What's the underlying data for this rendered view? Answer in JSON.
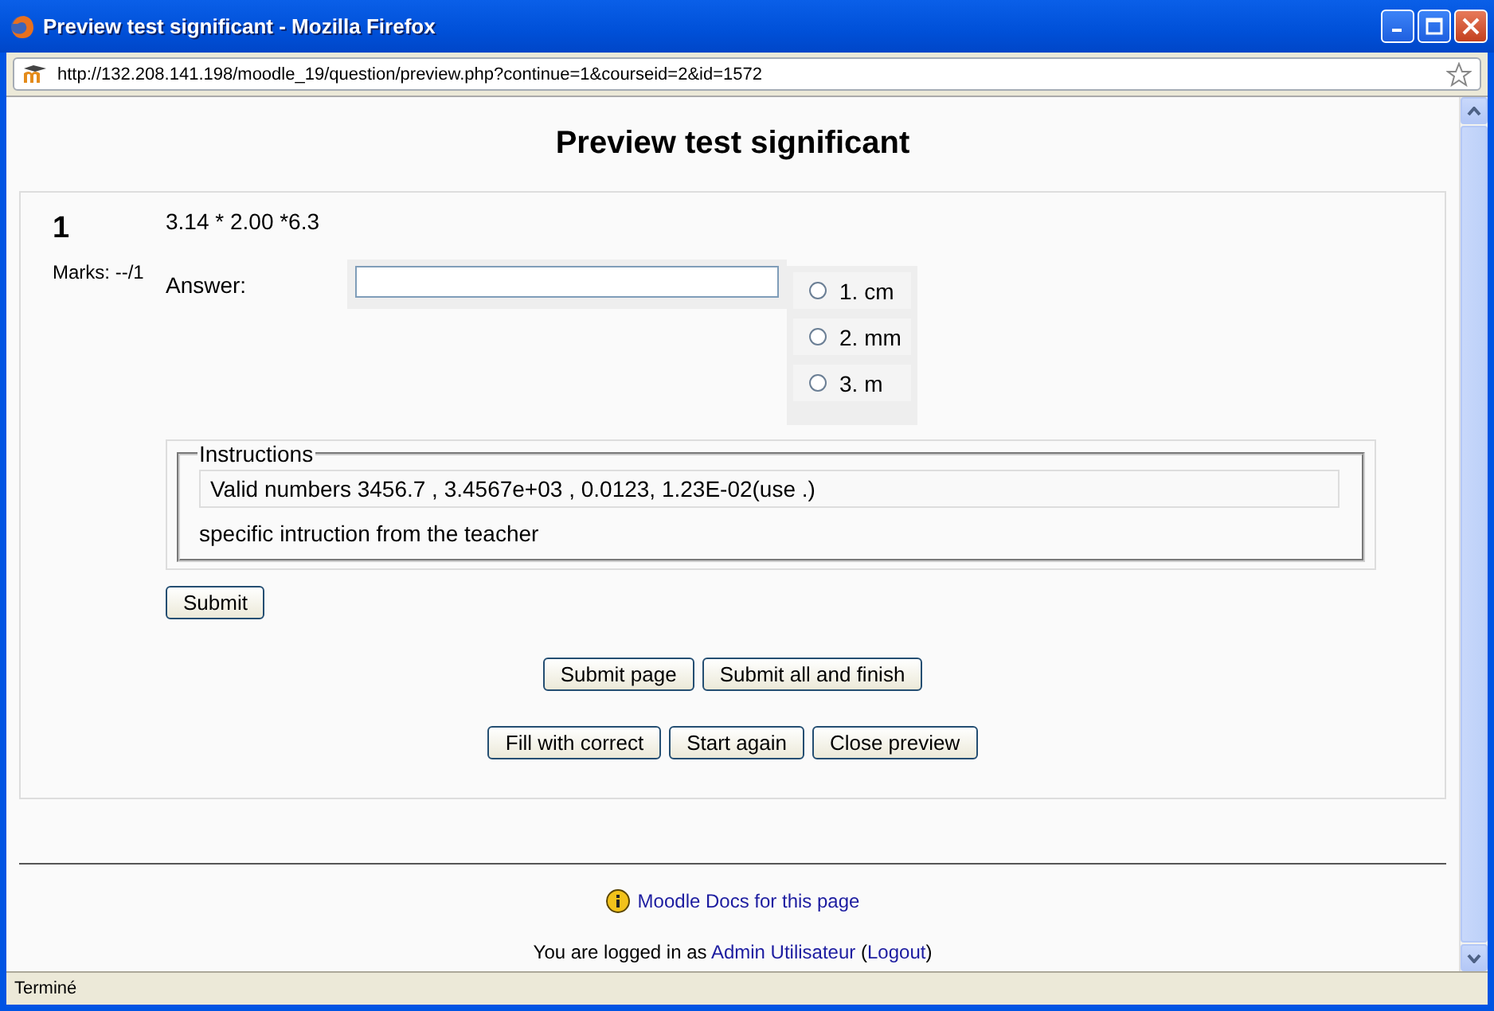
{
  "window": {
    "title": "Preview test significant - Mozilla Firefox",
    "url": "http://132.208.141.198/moodle_19/question/preview.php?continue=1&courseid=2&id=1572"
  },
  "page_title": "Preview test significant",
  "question": {
    "number": "1",
    "marks": "Marks: --/1",
    "text": "3.14 * 2.00 *6.3",
    "answer_label": "Answer:",
    "units": [
      {
        "label": "1. cm",
        "selected": false
      },
      {
        "label": "2. mm",
        "selected": false
      },
      {
        "label": "3. m",
        "selected": false
      }
    ],
    "instructions": {
      "legend": "Instructions",
      "hint": "Valid numbers 3456.7 , 3.4567e+03 , 0.0123, 1.23E-02(use .)",
      "text": "specific intruction from the teacher"
    },
    "submit": "Submit"
  },
  "page_buttons": [
    "Submit page",
    "Submit all and finish"
  ],
  "preview_buttons": [
    "Fill with correct",
    "Start again",
    "Close preview"
  ],
  "footer": {
    "docs_link": "Moodle Docs for this page",
    "login_prefix": "You are logged in as",
    "user": "Admin Utilisateur",
    "open_paren": "(",
    "logout": "Logout",
    "close_paren": ")"
  },
  "status_bar": "Terminé"
}
